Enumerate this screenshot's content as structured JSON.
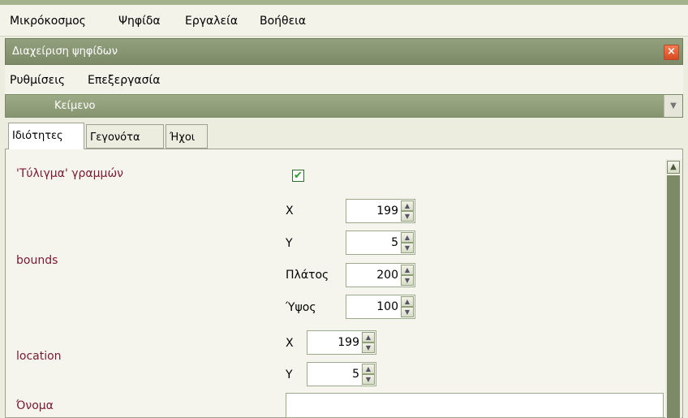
{
  "menubar": {
    "items": [
      "Μικρόκοσμος",
      "Ψηφίδα",
      "Εργαλεία",
      "Βοήθεια"
    ]
  },
  "panel": {
    "title": "Διαχείριση ψηφίδων",
    "close_label": "×"
  },
  "submenu": {
    "items": [
      "Ρυθμίσεις",
      "Επεξεργασία"
    ]
  },
  "section": {
    "title": "Κείμενο",
    "arrow": "▼"
  },
  "tabs": [
    {
      "label": "Ιδιότητες",
      "active": true
    },
    {
      "label": "Γεγονότα",
      "active": false
    },
    {
      "label": "Ήχοι",
      "active": false
    }
  ],
  "properties": {
    "wrap_label": "'Τύλιγμα' γραμμών",
    "wrap_checked": true,
    "wrap_check_glyph": "✔",
    "bounds_label": "bounds",
    "bounds": {
      "x_label": "X",
      "x_value": "199",
      "y_label": "Y",
      "y_value": "5",
      "width_label": "Πλάτος",
      "width_value": "200",
      "height_label": "Ύψος",
      "height_value": "100"
    },
    "location_label": "location",
    "location": {
      "x_label": "X",
      "x_value": "199",
      "y_label": "Y",
      "y_value": "5"
    },
    "name_label": "Όνομα",
    "name_value": ""
  },
  "spinner": {
    "up": "▲",
    "down": "▼"
  },
  "scrollbar": {
    "up": "▲"
  },
  "colors": {
    "accent": "#7C8A68",
    "label": "#7A1830",
    "close": "#E0582C"
  }
}
